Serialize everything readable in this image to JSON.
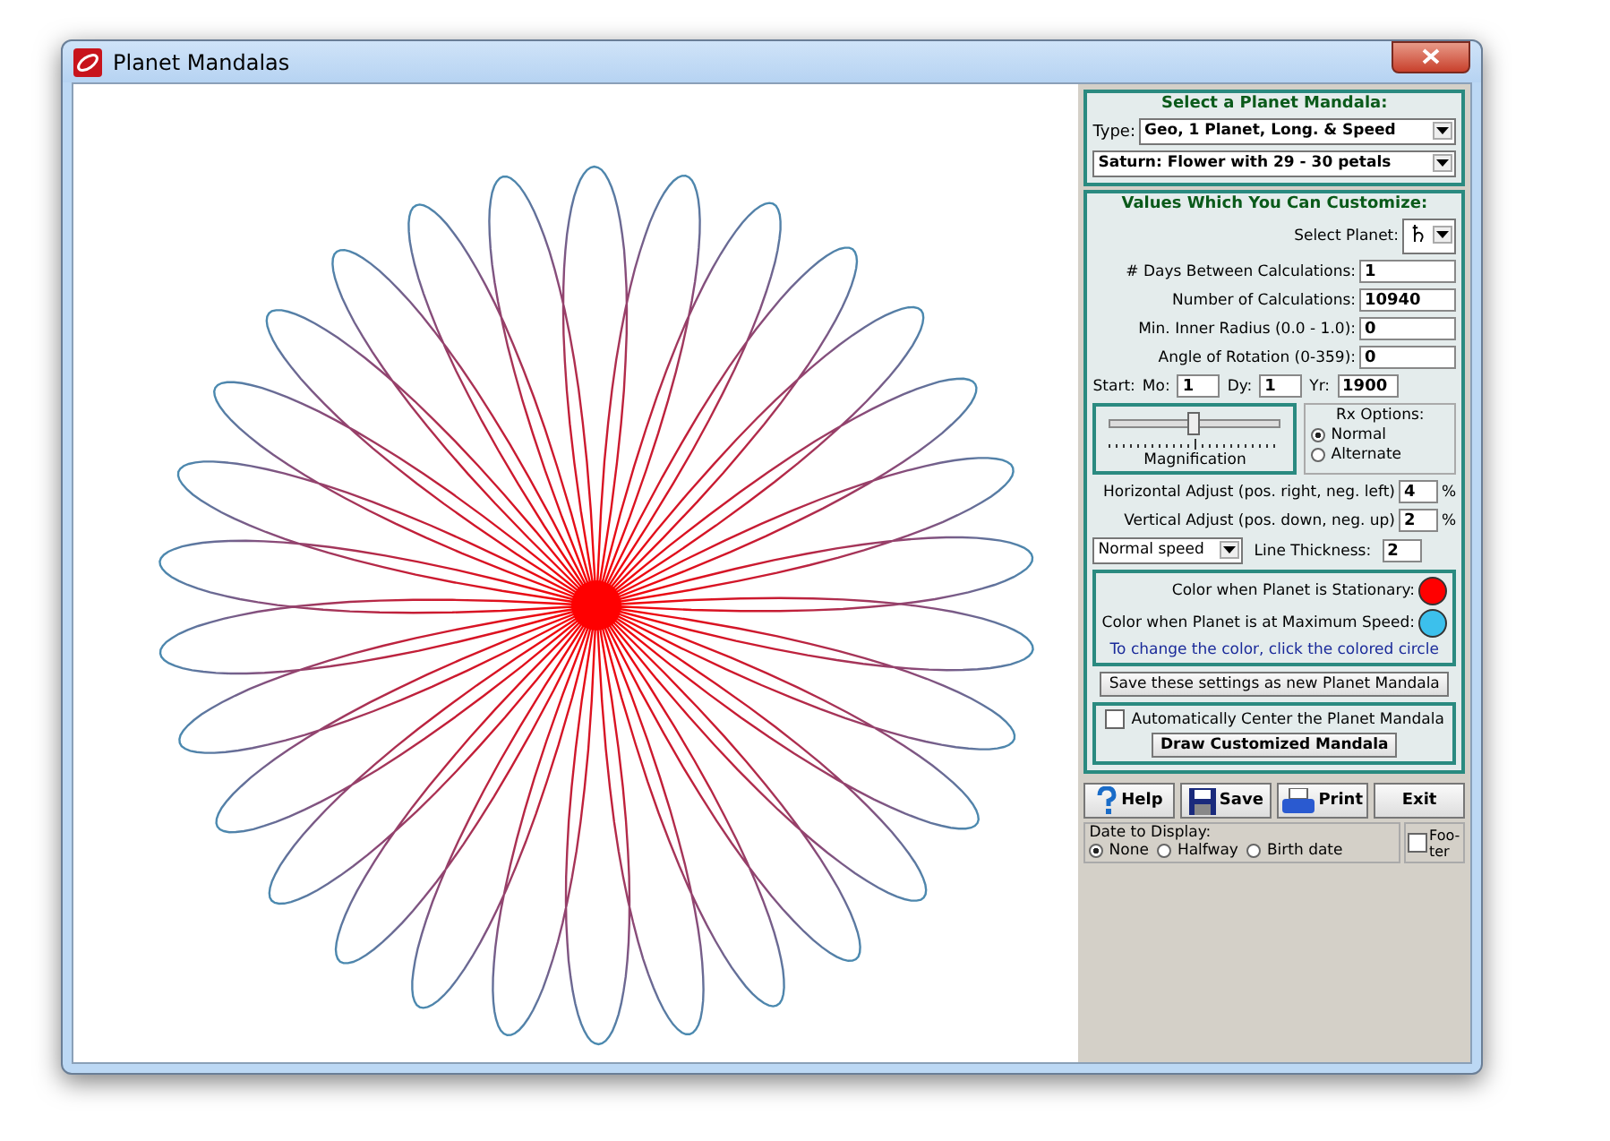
{
  "window": {
    "title": "Planet Mandalas"
  },
  "mandala_select": {
    "heading": "Select a Planet Mandala:",
    "type_label": "Type:",
    "type_value": "Geo,  1 Planet,  Long. & Speed",
    "mandala_value": "Saturn: Flower with 29 - 30 petals"
  },
  "customize": {
    "heading": "Values Which You Can Customize:",
    "planet_label": "Select Planet:",
    "planet_value": "♄",
    "fields": [
      {
        "label": "# Days Between Calculations:",
        "value": "1"
      },
      {
        "label": "Number of Calculations:",
        "value": "10940"
      },
      {
        "label": "Min. Inner Radius (0.0 - 1.0):",
        "value": "0"
      },
      {
        "label": "Angle of Rotation (0-359):",
        "value": "0"
      }
    ],
    "start_label": "Start:",
    "start_fields": [
      {
        "label": "Mo:",
        "value": "1"
      },
      {
        "label": "Dy:",
        "value": "1"
      },
      {
        "label": "Yr:",
        "value": "1900"
      }
    ],
    "magnification": {
      "label": "Magnification",
      "level": 0.5
    },
    "rx_options": {
      "title": "Rx Options:",
      "options": [
        {
          "label": "Normal",
          "selected": true
        },
        {
          "label": "Alternate",
          "selected": false
        }
      ]
    },
    "adjust_fields": [
      {
        "label": "Horizontal Adjust (pos. right,  neg. left)",
        "value": "4",
        "unit": "%"
      },
      {
        "label": "Vertical Adjust (pos. down,  neg. up)",
        "value": "2",
        "unit": "%"
      }
    ],
    "speed_value": "Normal speed",
    "thickness_label": "Line Thickness:",
    "thickness_value": "2",
    "colors": [
      {
        "label": "Color when Planet is Stationary:",
        "color": "#ff0000"
      },
      {
        "label": "Color when Planet is at Maximum Speed:",
        "color": "#3cc0ec"
      }
    ],
    "color_hint": "To change the color, click the colored circle",
    "save_button": "Save these settings as new Planet Mandala",
    "auto_center": {
      "label": "Automatically Center the Planet Mandala",
      "checked": false
    },
    "draw_button": "Draw Customized Mandala"
  },
  "buttons": [
    {
      "kind": "help",
      "label": "Help"
    },
    {
      "kind": "save",
      "label": "Save"
    },
    {
      "kind": "print",
      "label": "Print"
    },
    {
      "kind": "exit",
      "label": "Exit"
    }
  ],
  "date_display": {
    "title": "Date to Display:",
    "options": [
      {
        "label": "None",
        "selected": true
      },
      {
        "label": "Halfway",
        "selected": false
      },
      {
        "label": "Birth date",
        "selected": false
      }
    ]
  },
  "footer": {
    "label": "Foo- ter",
    "checked": false
  }
}
